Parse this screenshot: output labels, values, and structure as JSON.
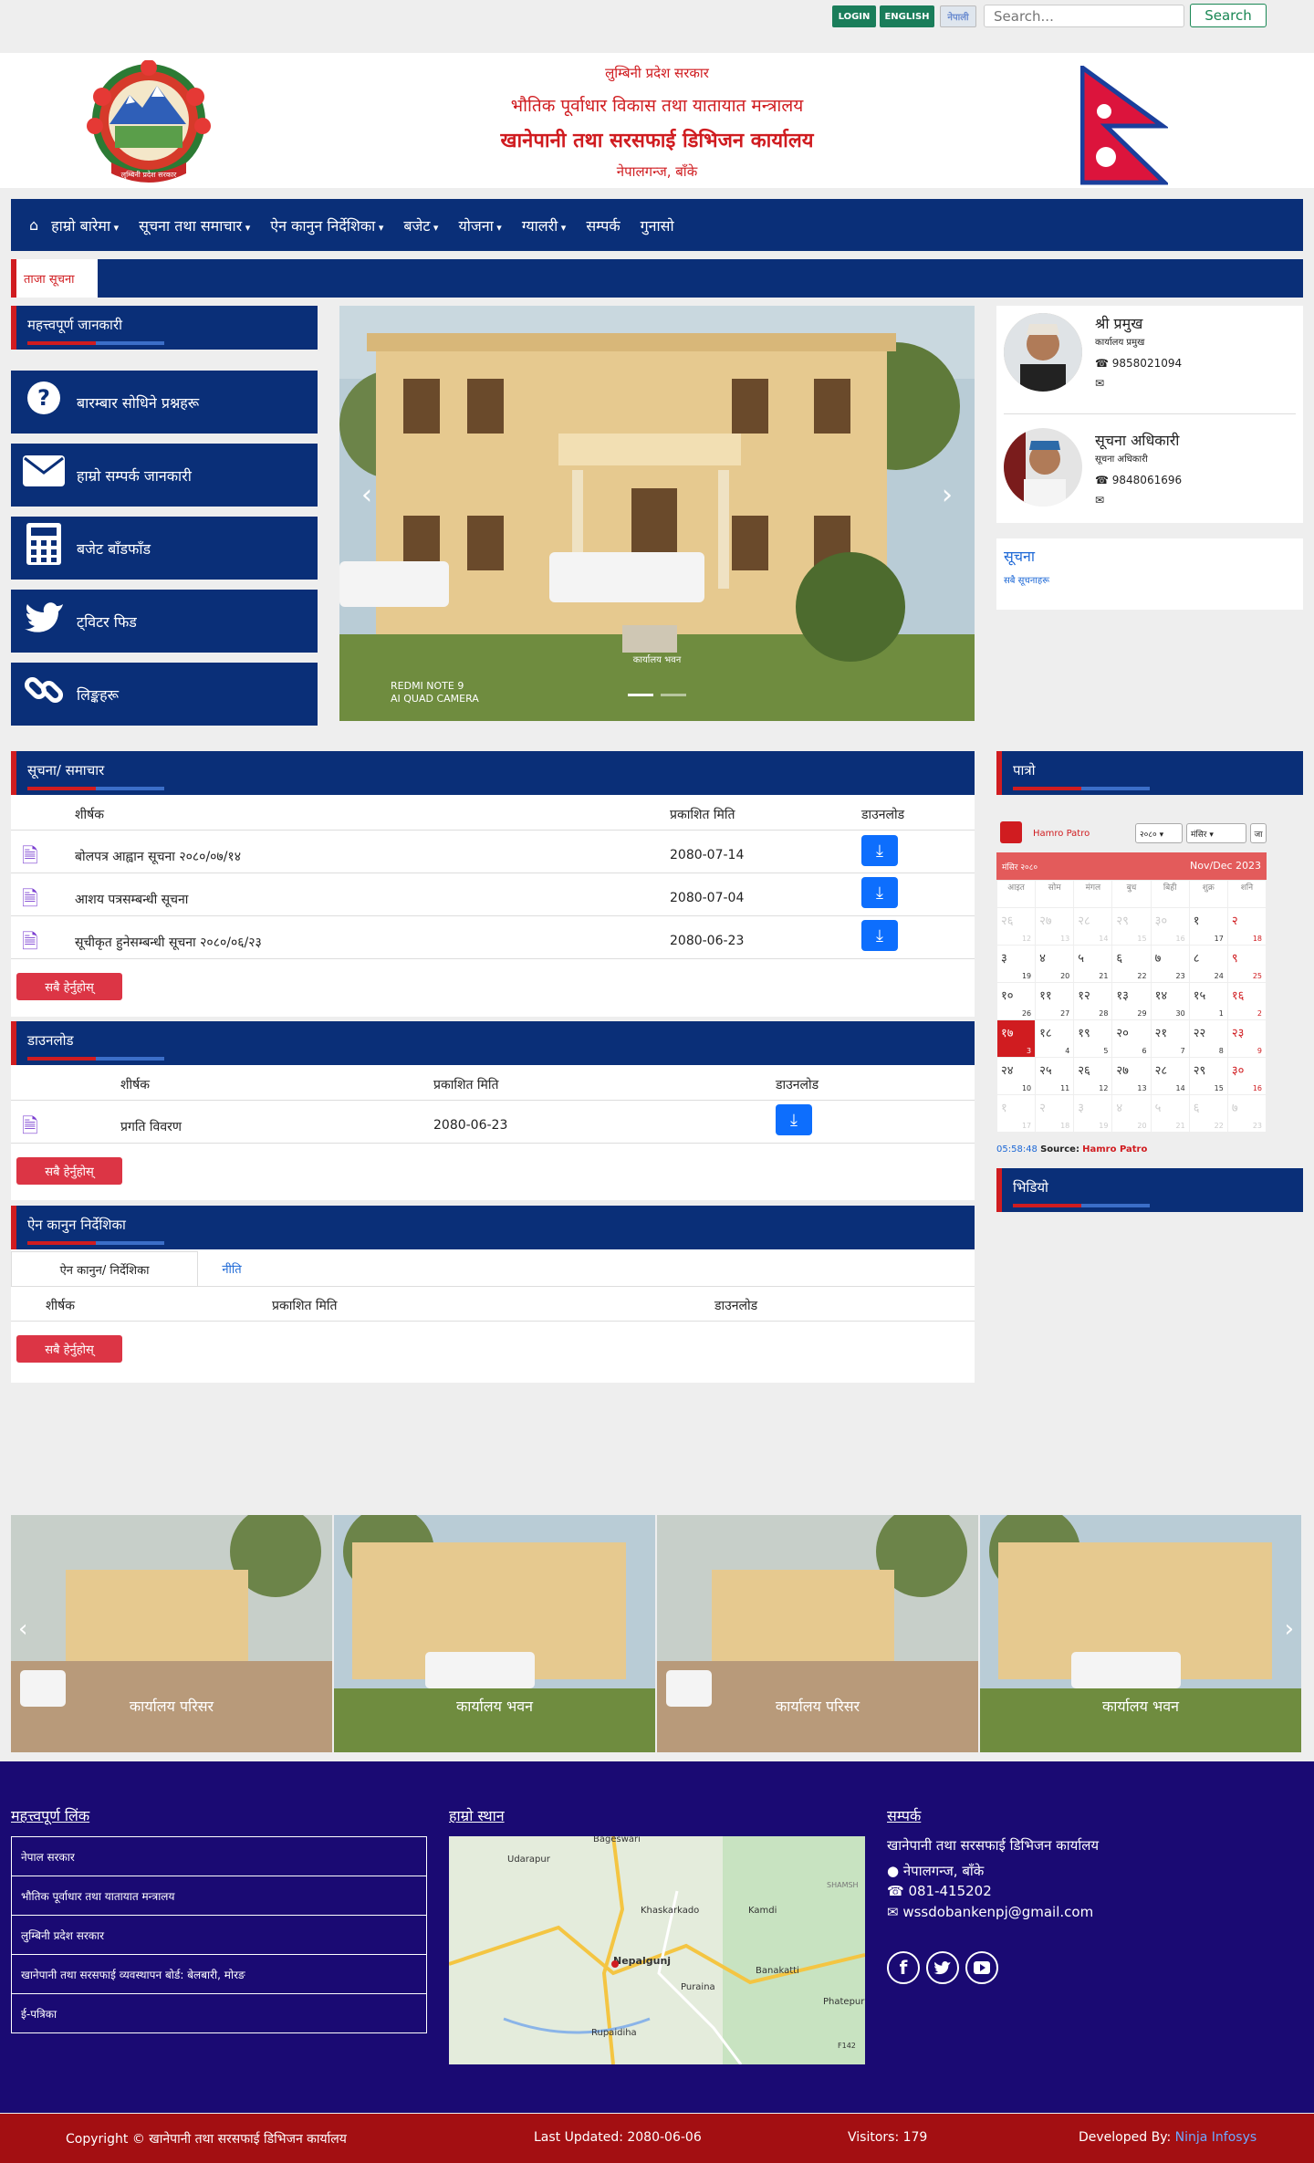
{
  "topbar": {
    "login": "LOGIN",
    "english": "ENGLISH",
    "nepali": "नेपाली",
    "search_placeholder": "Search...",
    "search_label": "Search"
  },
  "header": {
    "line1": "लुम्बिनी प्रदेश सरकार",
    "line2": "भौतिक पूर्वाधार विकास तथा यातायात मन्त्रालय",
    "line3": "खानेपानी तथा सरसफाई डिभिजन कार्यालय",
    "line4": "नेपालगन्ज, बाँके",
    "emblem_caption": "लुम्बिनी प्रदेश सरकार"
  },
  "nav": {
    "items": [
      {
        "label": "हाम्रो बारेमा",
        "dropdown": true
      },
      {
        "label": "सूचना तथा समाचार",
        "dropdown": true
      },
      {
        "label": "ऐन कानुन निर्देशिका",
        "dropdown": true
      },
      {
        "label": "बजेट",
        "dropdown": true
      },
      {
        "label": "योजना",
        "dropdown": true
      },
      {
        "label": "ग्यालरी",
        "dropdown": true
      },
      {
        "label": "सम्पर्क",
        "dropdown": false
      },
      {
        "label": "गुनासो",
        "dropdown": false
      }
    ]
  },
  "ticker": {
    "label": "ताजा सूचना"
  },
  "left": {
    "header": "महत्त्वपूर्ण जानकारी",
    "tiles": [
      {
        "label": "बारम्बार सोधिने प्रश्नहरू",
        "icon": "question-icon"
      },
      {
        "label": "हाम्रो सम्पर्क जानकारी",
        "icon": "envelope-icon"
      },
      {
        "label": "बजेट बाँडफाँड",
        "icon": "calculator-icon"
      },
      {
        "label": "ट्विटर फिड",
        "icon": "twitter-icon"
      },
      {
        "label": "लिङ्कहरू",
        "icon": "link-icon"
      }
    ]
  },
  "slider": {
    "caption": "कार्यालय भवन",
    "camera_line1": "REDMI NOTE 9",
    "camera_line2": "AI QUAD CAMERA"
  },
  "officials": [
    {
      "name": "श्री प्रमुख",
      "title": "कार्यालय प्रमुख",
      "phone": "9858021094"
    },
    {
      "name": "सूचना अधिकारी",
      "title": "सूचना अधिकारी",
      "phone": "9848061696"
    }
  ],
  "notice_box": {
    "title": "सूचना",
    "text": "सबै सूचनाहरू"
  },
  "news": {
    "header": "सूचना/ समाचार",
    "columns": [
      "शीर्षक",
      "प्रकाशित मिति",
      "डाउनलोड"
    ],
    "rows": [
      {
        "title": "बोलपत्र आह्वान सूचना २०८०/०७/१४",
        "date": "2080-07-14"
      },
      {
        "title": "आशय पत्रसम्बन्धी सूचना",
        "date": "2080-07-04"
      },
      {
        "title": "सूचीकृत हुनेसम्बन्धी सूचना २०८०/०६/२३",
        "date": "2080-06-23"
      }
    ],
    "more": "सबै हेर्नुहोस्"
  },
  "downloads": {
    "header": "डाउनलोड",
    "columns": [
      "शीर्षक",
      "प्रकाशित मिति",
      "डाउनलोड"
    ],
    "rows": [
      {
        "title": "प्रगति विवरण",
        "date": "2080-06-23"
      }
    ],
    "more": "सबै हेर्नुहोस्"
  },
  "laws": {
    "header": "ऐन कानुन निर्देशिका",
    "tabs": [
      "ऐन कानुन/ निर्देशिका",
      "नीति"
    ],
    "columns": [
      "शीर्षक",
      "प्रकाशित मिति",
      "डाउनलोड"
    ],
    "more": "सबै हेर्नुहोस्"
  },
  "calendar": {
    "header": "पात्रो",
    "brand": "Hamro Patro",
    "year_option": "२०८०",
    "month_option": "मंसिर",
    "go": "जा",
    "month_label": "मंसिर २०८०",
    "en_range": "Nov/Dec 2023",
    "weekdays": [
      "आइत",
      "सोम",
      "मंगल",
      "बुध",
      "बिही",
      "शुक्र",
      "शनि"
    ],
    "weeks": [
      [
        [
          "२६",
          "12"
        ],
        [
          "२७",
          "13"
        ],
        [
          "२८",
          "14"
        ],
        [
          "२९",
          "15"
        ],
        [
          "३०",
          "16"
        ],
        [
          "१",
          "17"
        ],
        [
          "२",
          "18"
        ]
      ],
      [
        [
          "३",
          "19"
        ],
        [
          "४",
          "20"
        ],
        [
          "५",
          "21"
        ],
        [
          "६",
          "22"
        ],
        [
          "७",
          "23"
        ],
        [
          "८",
          "24"
        ],
        [
          "९",
          "25"
        ]
      ],
      [
        [
          "१०",
          "26"
        ],
        [
          "११",
          "27"
        ],
        [
          "१२",
          "28"
        ],
        [
          "१३",
          "29"
        ],
        [
          "१४",
          "30"
        ],
        [
          "१५",
          "1"
        ],
        [
          "१६",
          "2"
        ]
      ],
      [
        [
          "१७",
          "3"
        ],
        [
          "१८",
          "4"
        ],
        [
          "१९",
          "5"
        ],
        [
          "२०",
          "6"
        ],
        [
          "२१",
          "7"
        ],
        [
          "२२",
          "8"
        ],
        [
          "२३",
          "9"
        ]
      ],
      [
        [
          "२४",
          "10"
        ],
        [
          "२५",
          "11"
        ],
        [
          "२६",
          "12"
        ],
        [
          "२७",
          "13"
        ],
        [
          "२८",
          "14"
        ],
        [
          "२९",
          "15"
        ],
        [
          "३०",
          "16"
        ]
      ],
      [
        [
          "१",
          "17"
        ],
        [
          "२",
          "18"
        ],
        [
          "३",
          "19"
        ],
        [
          "४",
          "20"
        ],
        [
          "५",
          "21"
        ],
        [
          "६",
          "22"
        ],
        [
          "७",
          "23"
        ]
      ]
    ],
    "time": "05:58:48",
    "source_label": "Source:",
    "source_name": "Hamro Patro"
  },
  "videos": {
    "header": "भिडियो"
  },
  "gallery": {
    "items": [
      {
        "caption": "कार्यालय परिसर"
      },
      {
        "caption": "कार्यालय भवन"
      },
      {
        "caption": "कार्यालय परिसर"
      },
      {
        "caption": "कार्यालय भवन"
      }
    ]
  },
  "footer": {
    "links_header": "महत्त्वपूर्ण लिंक",
    "links": [
      "नेपाल सरकार",
      "भौतिक पूर्वाधार तथा यातायात मन्त्रालय",
      "लुम्बिनी प्रदेश सरकार",
      "खानेपानी तथा सरसफाई व्यवस्थापन बोर्ड: बेलबारी, मोरङ",
      "ई-पत्रिका"
    ],
    "map_header": "हाम्रो स्थान",
    "map_labels": [
      "Bageswari",
      "Udarapur",
      "Khaskarkado",
      "Kamdi",
      "Nepalgunj",
      "Banakatti",
      "Puraina",
      "Phatepur",
      "Rupaidiha",
      "SHAMSH",
      "F142"
    ],
    "contact_header": "सम्पर्क",
    "office": "खानेपानी तथा सरसफाई डिभिजन कार्यालय",
    "address": "नेपालगन्ज, बाँके",
    "phone": "081-415202",
    "email": "wssdobankenpj@gmail.com"
  },
  "bottom": {
    "copyright": "Copyright © खानेपानी तथा सरसफाई डिभिजन कार्यालय",
    "updated": "Last Updated: 2080-06-06",
    "visitors": "Visitors: 179",
    "dev_label": "Developed By:",
    "dev_name": "Ninja Infosys"
  },
  "colors": {
    "primary": "#0a2f78",
    "accent": "#d01c20",
    "footer": "#1a0a73",
    "bottom": "#a30f12"
  }
}
